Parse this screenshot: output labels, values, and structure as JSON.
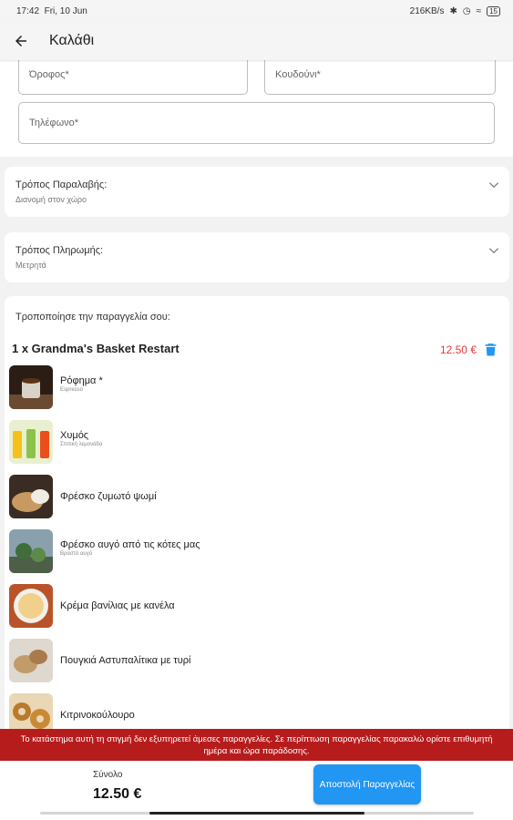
{
  "status": {
    "time": "17:42",
    "date": "Fri, 10 Jun",
    "speed": "216KB/s",
    "battery": "15"
  },
  "appbar": {
    "title": "Καλάθι"
  },
  "address": {
    "floor_placeholder": "Όροφος*",
    "bell_placeholder": "Κουδούνι*",
    "phone_placeholder": "Τηλέφωνο*"
  },
  "pickup": {
    "label": "Τρόπος Παραλαβής:",
    "value": "Διανομή στον χώρο"
  },
  "payment": {
    "label": "Τρόπος Πληρωμής:",
    "value": "Μετρητά"
  },
  "order": {
    "heading": "Τροποποίησε την παραγγελία σου:",
    "product_name": "1 x Grandma's Basket Restart",
    "product_price": "12.50 €",
    "items": [
      {
        "name": "Ρόφημα *",
        "sub": "Espresso"
      },
      {
        "name": "Χυμός",
        "sub": "Σπιτική λεμονάδα"
      },
      {
        "name": "Φρέσκο ζυμωτό ψωμί",
        "sub": ""
      },
      {
        "name": "Φρέσκο αυγό από τις κότες μας",
        "sub": "Βραστό αυγό"
      },
      {
        "name": "Κρέμα βανίλιας με κανέλα",
        "sub": ""
      },
      {
        "name": "Πουγκιά Αστυπαλίτικα με τυρί",
        "sub": ""
      },
      {
        "name": "Κιτρινοκούλουρο",
        "sub": ""
      }
    ]
  },
  "banner": {
    "text": "Το κατάστημα αυτή τη στιγμή δεν εξυπηρετεί άμεσες παραγγελίες. Σε περίπτωση παραγγελίας παρακαλώ ορίστε επιθυμητή ημέρα και ώρα παράδοσης."
  },
  "footer": {
    "total_label": "Σύνολο",
    "total_value": "12.50 €",
    "send_label": "Αποστολή Παραγγελίας"
  },
  "colors": {
    "accent": "#2196f3",
    "price": "#e53935",
    "banner": "#b71c1c"
  }
}
